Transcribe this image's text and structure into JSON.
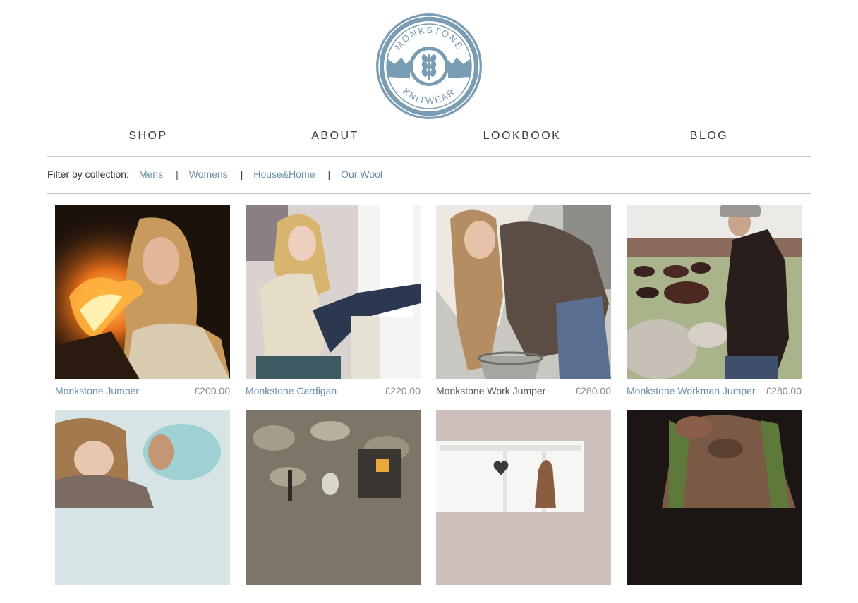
{
  "brand": {
    "top_text": "MONKSTONE",
    "bottom_text": "KNITWEAR",
    "color": "#7b9db3"
  },
  "nav": {
    "items": [
      {
        "label": "SHOP"
      },
      {
        "label": "ABOUT"
      },
      {
        "label": "LOOKBOOK"
      },
      {
        "label": "BLOG"
      }
    ]
  },
  "filter": {
    "label": "Filter by collection:",
    "options": [
      {
        "label": "Mens"
      },
      {
        "label": "Womens"
      },
      {
        "label": "House&Home"
      },
      {
        "label": "Our Wool"
      }
    ]
  },
  "products": [
    {
      "name": "Monkstone Jumper",
      "price": "£200.00"
    },
    {
      "name": "Monkstone Cardigan",
      "price": "£220.00"
    },
    {
      "name": "Monkstone Work Jumper",
      "price": "£280.00"
    },
    {
      "name": "Monkstone Workman Jumper",
      "price": "£280.00"
    },
    {
      "name": "",
      "price": ""
    },
    {
      "name": "",
      "price": ""
    },
    {
      "name": "",
      "price": ""
    },
    {
      "name": "",
      "price": ""
    }
  ],
  "colors": {
    "link": "#6b8fa6",
    "price": "#8a8a8a",
    "rule": "#c8c8c8"
  }
}
